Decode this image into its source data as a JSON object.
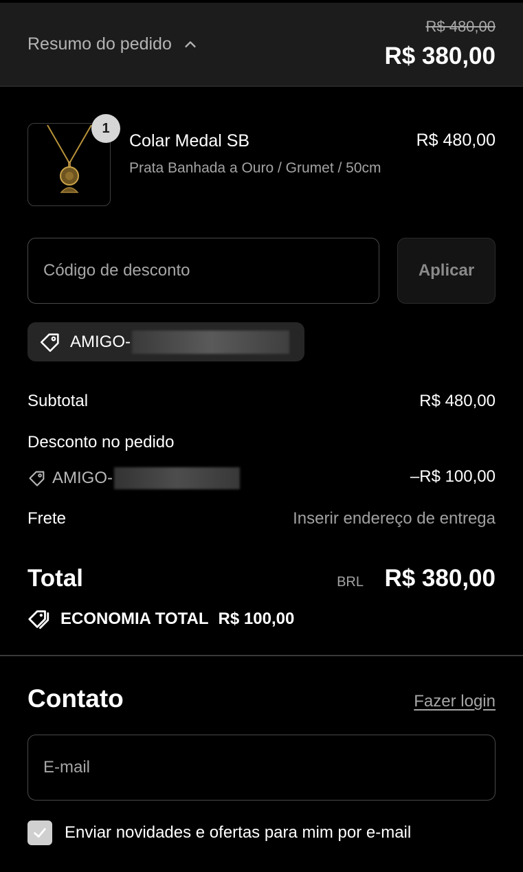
{
  "header": {
    "summary_label": "Resumo do pedido",
    "original_price": "R$ 480,00",
    "total_price": "R$ 380,00"
  },
  "product": {
    "quantity": "1",
    "name": "Colar Medal SB",
    "variant": "Prata Banhada a Ouro / Grumet / 50cm",
    "price": "R$ 480,00",
    "image_icon": "necklace-icon"
  },
  "discount": {
    "placeholder": "Código de desconto",
    "apply_label": "Aplicar",
    "applied_code_prefix": "AMIGO-"
  },
  "totals": {
    "subtotal_label": "Subtotal",
    "subtotal_value": "R$ 480,00",
    "discount_label": "Desconto no pedido",
    "discount_code_prefix": "AMIGO-",
    "discount_value": "–R$ 100,00",
    "shipping_label": "Frete",
    "shipping_value": "Inserir endereço de entrega",
    "total_label": "Total",
    "currency": "BRL",
    "total_value": "R$ 380,00",
    "savings_label": "ECONOMIA TOTAL",
    "savings_value": "R$ 100,00"
  },
  "contact": {
    "title": "Contato",
    "login_link": "Fazer login",
    "email_placeholder": "E-mail",
    "newsletter_label": "Enviar novidades e ofertas para mim por e-mail",
    "newsletter_checked": true
  },
  "colors": {
    "background": "#000000",
    "header_background": "#1c1c1c",
    "muted_text": "#a6a6a6",
    "chip_background": "#262626"
  }
}
